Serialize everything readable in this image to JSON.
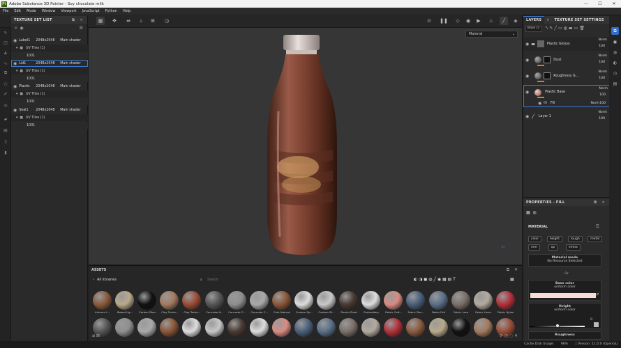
{
  "window": {
    "title": "Adobe Substance 3D Painter - Soy chocolate milk",
    "logo": "Pt"
  },
  "menu": [
    "File",
    "Edit",
    "Mode",
    "Window",
    "Viewport",
    "JavaScript",
    "Python",
    "Help"
  ],
  "viewport": {
    "material_dropdown": "Material"
  },
  "texture_set_list": {
    "title": "TEXTURE SET LIST",
    "sets": [
      {
        "name": "Label1",
        "res": "2048x2048",
        "shader": "Main shader",
        "uv": "UV Tiles (1)",
        "tile": "1001"
      },
      {
        "name": "Lid1",
        "res": "2048x2048",
        "shader": "Main shader",
        "uv": "UV Tiles (1)",
        "tile": "1001"
      },
      {
        "name": "Plastic",
        "res": "2048x2048",
        "shader": "Main shader",
        "uv": "UV Tiles (1)",
        "tile": "1001"
      },
      {
        "name": "Seal1",
        "res": "2048x2048",
        "shader": "Main shader",
        "uv": "UV Tiles (1)",
        "tile": "1001"
      }
    ]
  },
  "layers": {
    "tabs": [
      "LAYERS",
      "TEXTURE SET SETTINGS"
    ],
    "channel_select": "Base cc",
    "items": [
      {
        "name": "Plastic Glossy",
        "blend": "Norm",
        "opacity": "100"
      },
      {
        "name": "Dust",
        "blend": "Norm",
        "opacity": "100"
      },
      {
        "name": "Roughness G...",
        "blend": "Norm",
        "opacity": "100"
      },
      {
        "name": "Plastic Base",
        "blend": "Norm",
        "opacity": "100"
      },
      {
        "name": "Layer 1",
        "blend": "Norm",
        "opacity": "100"
      }
    ],
    "fill": {
      "name": "Fill",
      "blend": "Norm",
      "opacity": "100"
    }
  },
  "properties": {
    "title": "PROPERTIES - FILL",
    "section": "MATERIAL",
    "channels": [
      "color",
      "height",
      "rough",
      "metal",
      "nrm",
      "op",
      "emiss"
    ],
    "material_mode_label": "Material mode",
    "material_mode_value": "No Resource Selected",
    "or": "Or",
    "base_color_label": "Base color",
    "base_color_sub": "uniform color",
    "height_label": "Height",
    "height_sub": "uniform color",
    "height_value": "0",
    "roughness_label": "Roughness"
  },
  "assets": {
    "title": "ASSETS",
    "library": "All libraries",
    "search_placeholder": "Search",
    "row1": [
      "Autumn L...",
      "Baked Lig...",
      "Carbon Fiber",
      "Clay Tertra...",
      "Clay Tertre...",
      "Concrete A...",
      "Concrete C...",
      "Concrete C...",
      "Cork Natural",
      "Custom Sp...",
      "Custom St...",
      "Denim Rivet",
      "Embroidery",
      "Fabric Cott...",
      "Fabric Den...",
      "Fabric Felt",
      "Fabric Lace",
      "Fabric Linen",
      "Fabric Nylon"
    ]
  },
  "status": {
    "cache": "Cache Disk Usage:",
    "cache_value": "98%",
    "version": "| Version: 11.0.0 (OpenGL)"
  },
  "colors": {
    "accent": "#3d7ad1",
    "base_color_swatch": "#f5dcd6"
  }
}
